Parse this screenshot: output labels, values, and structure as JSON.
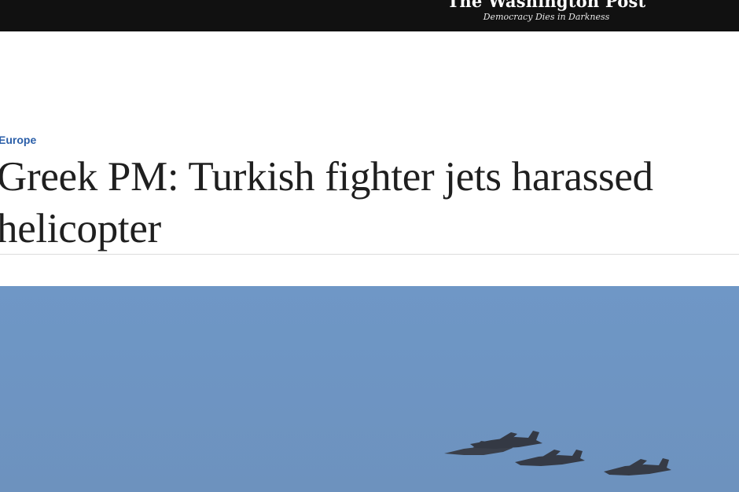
{
  "masthead": {
    "name": "The Washington Post",
    "tagline": "Democracy Dies in Darkness"
  },
  "article": {
    "section": "Europe",
    "headline": "Greek PM: Turkish fighter jets harassed helicopter"
  },
  "hero_image": {
    "subject": "fighter jets in flight",
    "sky_color": "#6f97c6",
    "aircraft_color": "#3a3f4a"
  }
}
